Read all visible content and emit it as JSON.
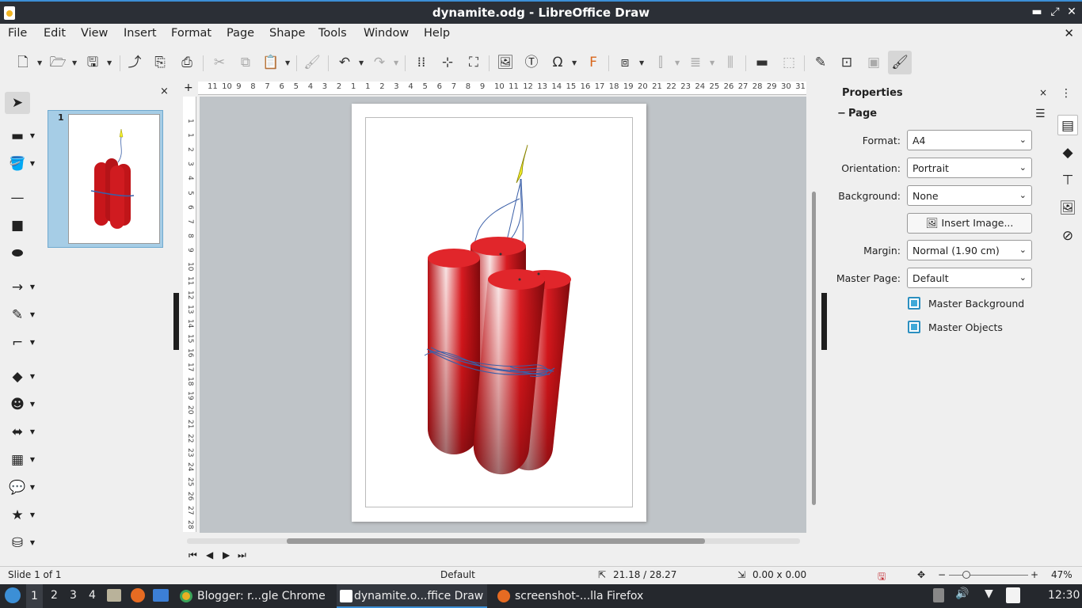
{
  "window": {
    "title": "dynamite.odg - LibreOffice Draw",
    "minimize": "▬",
    "maximize": "⤢",
    "close": "✕"
  },
  "menu": [
    "File",
    "Edit",
    "View",
    "Insert",
    "Format",
    "Page",
    "Shape",
    "Tools",
    "Window",
    "Help"
  ],
  "menu_close": "✕",
  "toolbar": {
    "icons": [
      "new-icon",
      "open-icon",
      "save-icon",
      "export-icon",
      "export-pdf-icon",
      "print-icon",
      "cut-icon",
      "copy-icon",
      "paste-icon",
      "clone-formatting-icon",
      "undo-icon",
      "redo-icon",
      "grid-icon",
      "helplines-icon",
      "zoom-page-icon",
      "insert-image-icon",
      "insert-textbox-icon",
      "special-character-icon",
      "fontwork-icon",
      "transformations-icon",
      "align-icon",
      "arrange-icon",
      "distribute-icon",
      "shadow-icon",
      "crop-icon",
      "points-icon",
      "glue-points-icon",
      "toggle-extrusion-icon",
      "show-draw-functions-icon"
    ]
  },
  "slides_pane": {
    "close": "×",
    "slide_number": "1"
  },
  "ruler": {
    "h_ticks": [
      "11",
      "10",
      "9",
      "8",
      "7",
      "6",
      "5",
      "4",
      "3",
      "2",
      "1",
      "1",
      "2",
      "3",
      "4",
      "5",
      "6",
      "7",
      "8",
      "9",
      "10",
      "11",
      "12",
      "13",
      "14",
      "15",
      "16",
      "17",
      "18",
      "19",
      "20",
      "21",
      "22",
      "23",
      "24",
      "25",
      "26",
      "27",
      "28",
      "29",
      "30",
      "31"
    ],
    "v_ticks": [
      "1",
      "1",
      "2",
      "3",
      "4",
      "5",
      "6",
      "7",
      "8",
      "9",
      "10",
      "11",
      "12",
      "13",
      "14",
      "15",
      "16",
      "17",
      "18",
      "19",
      "20",
      "21",
      "22",
      "23",
      "24",
      "25",
      "26",
      "27",
      "28",
      "29"
    ]
  },
  "sidebar": {
    "title": "Properties",
    "close": "×",
    "section": "Page",
    "format_label": "Format:",
    "format_value": "A4",
    "orientation_label": "Orientation:",
    "orientation_value": "Portrait",
    "background_label": "Background:",
    "background_value": "None",
    "insert_image_label": "Insert Image...",
    "margin_label": "Margin:",
    "margin_value": "Normal (1.90 cm)",
    "master_page_label": "Master Page:",
    "master_page_value": "Default",
    "master_background_label": "Master Background",
    "master_objects_label": "Master Objects"
  },
  "statusbar": {
    "slide": "Slide 1 of 1",
    "layout": "Default",
    "position": "21.18 / 28.27",
    "size": "0.00 x 0.00",
    "zoom_minus": "−",
    "zoom_plus": "+",
    "zoom": "47%"
  },
  "taskbar": {
    "workspaces": [
      "1",
      "2",
      "3",
      "4"
    ],
    "apps": [
      {
        "label": "Blogger: r...gle Chrome"
      },
      {
        "label": "dynamite.o...ffice Draw"
      },
      {
        "label": "screenshot-...lla Firefox"
      }
    ],
    "clock": "12:30"
  },
  "colors": {
    "accent": "#3c8fd6",
    "dynamite_red": "#c8161b",
    "fuse_flame": "#f4f02a",
    "tape_blue": "#3a5fa8"
  }
}
